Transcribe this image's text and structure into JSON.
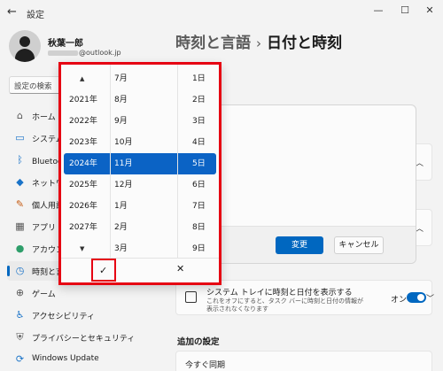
{
  "window": {
    "title": "設定",
    "back_glyph": "←",
    "minimize_glyph": "—",
    "maximize_glyph": "☐",
    "close_glyph": "✕"
  },
  "profile": {
    "name": "秋葉一郎",
    "email_suffix": "@outlook.jp"
  },
  "search": {
    "placeholder": "設定の検索"
  },
  "sidebar": {
    "items": [
      {
        "label": "ホーム",
        "icon": "home-icon",
        "glyph": "⌂"
      },
      {
        "label": "システム",
        "icon": "system-icon",
        "glyph": "▭"
      },
      {
        "label": "Bluetooth とデバイス",
        "icon": "bluetooth-icon",
        "glyph": "ᛒ"
      },
      {
        "label": "ネットワークとインターネット",
        "icon": "wifi-icon",
        "glyph": "◆"
      },
      {
        "label": "個人用設定",
        "icon": "brush-icon",
        "glyph": "✎"
      },
      {
        "label": "アプリ",
        "icon": "apps-icon",
        "glyph": "▦"
      },
      {
        "label": "アカウント",
        "icon": "account-icon",
        "glyph": "●"
      },
      {
        "label": "時刻と言語",
        "icon": "globe-clock-icon",
        "glyph": "◷"
      },
      {
        "label": "ゲーム",
        "icon": "gamepad-icon",
        "glyph": "⊕"
      },
      {
        "label": "アクセシビリティ",
        "icon": "accessibility-icon",
        "glyph": "♿"
      },
      {
        "label": "プライバシーとセキュリティ",
        "icon": "shield-icon",
        "glyph": "⛨"
      },
      {
        "label": "Windows Update",
        "icon": "update-icon",
        "glyph": "⟳"
      }
    ]
  },
  "header": {
    "parent": "時刻と言語",
    "separator": "›",
    "current": "日付と時刻"
  },
  "dialog": {
    "primary_label": "変更",
    "secondary_label": "キャンセル"
  },
  "tray_setting": {
    "title": "システム トレイに時刻と日付を表示する",
    "description": "これをオフにすると、タスク バーに時刻と日付の情報が表示されなくなります",
    "state": "オン"
  },
  "additional": {
    "section_title": "追加の設定",
    "sync_label": "今すぐ同期"
  },
  "picker": {
    "up_arrow": "▲",
    "down_arrow": "▼",
    "years": [
      "",
      "2021年",
      "2022年",
      "2023年",
      "2024年",
      "2025年",
      "2026年",
      "2027年",
      ""
    ],
    "months": [
      "7月",
      "8月",
      "9月",
      "10月",
      "11月",
      "12月",
      "1月",
      "2月",
      "3月"
    ],
    "days": [
      "1日",
      "2日",
      "3日",
      "4日",
      "5日",
      "6日",
      "7日",
      "8日",
      "9日"
    ],
    "selected_index": 4,
    "accept_glyph": "✓",
    "cancel_glyph": "✕"
  }
}
